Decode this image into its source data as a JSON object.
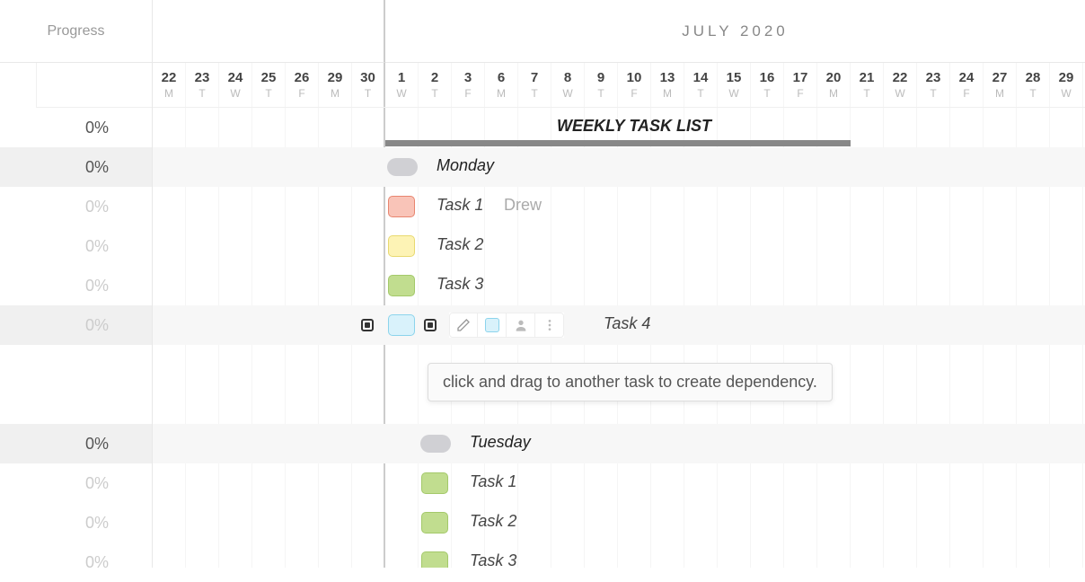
{
  "sidebar": {
    "header": "Progress",
    "rows": [
      {
        "value": "0%",
        "dim": false,
        "highlighted": false
      },
      {
        "value": "0%",
        "dim": false,
        "highlighted": true
      },
      {
        "value": "0%",
        "dim": true,
        "highlighted": false
      },
      {
        "value": "0%",
        "dim": true,
        "highlighted": false
      },
      {
        "value": "0%",
        "dim": true,
        "highlighted": false
      },
      {
        "value": "0%",
        "dim": true,
        "highlighted": true
      },
      {
        "value": "",
        "dim": true,
        "highlighted": false
      },
      {
        "value": "",
        "dim": true,
        "highlighted": false
      },
      {
        "value": "0%",
        "dim": false,
        "highlighted": true
      },
      {
        "value": "0%",
        "dim": true,
        "highlighted": false
      },
      {
        "value": "0%",
        "dim": true,
        "highlighted": false
      },
      {
        "value": "0%",
        "dim": true,
        "highlighted": false
      }
    ]
  },
  "month_label": "JULY 2020",
  "dates": [
    {
      "num": "22",
      "day": "M"
    },
    {
      "num": "23",
      "day": "T"
    },
    {
      "num": "24",
      "day": "W"
    },
    {
      "num": "25",
      "day": "T"
    },
    {
      "num": "26",
      "day": "F"
    },
    {
      "num": "29",
      "day": "M"
    },
    {
      "num": "30",
      "day": "T"
    },
    {
      "num": "1",
      "day": "W"
    },
    {
      "num": "2",
      "day": "T"
    },
    {
      "num": "3",
      "day": "F"
    },
    {
      "num": "6",
      "day": "M"
    },
    {
      "num": "7",
      "day": "T"
    },
    {
      "num": "8",
      "day": "W"
    },
    {
      "num": "9",
      "day": "T"
    },
    {
      "num": "10",
      "day": "F"
    },
    {
      "num": "13",
      "day": "M"
    },
    {
      "num": "14",
      "day": "T"
    },
    {
      "num": "15",
      "day": "W"
    },
    {
      "num": "16",
      "day": "T"
    },
    {
      "num": "17",
      "day": "F"
    },
    {
      "num": "20",
      "day": "M"
    },
    {
      "num": "21",
      "day": "T"
    },
    {
      "num": "22",
      "day": "W"
    },
    {
      "num": "23",
      "day": "T"
    },
    {
      "num": "24",
      "day": "F"
    },
    {
      "num": "27",
      "day": "M"
    },
    {
      "num": "28",
      "day": "T"
    },
    {
      "num": "29",
      "day": "W"
    }
  ],
  "summary": {
    "title": "WEEKLY TASK LIST",
    "bar_start_col": 7,
    "bar_end_col": 21
  },
  "monday": {
    "label": "Monday",
    "tasks": [
      {
        "label": "Task 1",
        "assignee": "Drew",
        "color": "red"
      },
      {
        "label": "Task 2",
        "assignee": "",
        "color": "yellow"
      },
      {
        "label": "Task 3",
        "assignee": "",
        "color": "green"
      },
      {
        "label": "Task 4",
        "assignee": "",
        "color": "blue",
        "selected": true
      }
    ]
  },
  "tuesday": {
    "label": "Tuesday",
    "tasks": [
      {
        "label": "Task 1",
        "assignee": "",
        "color": "green"
      },
      {
        "label": "Task 2",
        "assignee": "",
        "color": "green"
      },
      {
        "label": "Task 3",
        "assignee": "",
        "color": "green"
      }
    ]
  },
  "tooltip": "click and drag to another task to create dependency.",
  "icons": {
    "pencil": "pencil-icon",
    "color": "color-swatch-icon",
    "person": "person-icon",
    "more": "more-vertical-icon"
  }
}
